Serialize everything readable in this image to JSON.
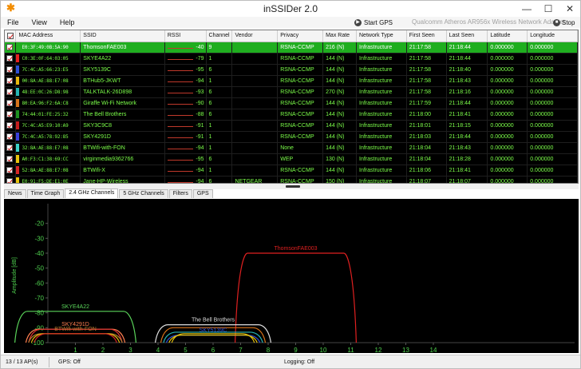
{
  "window": {
    "title": "inSSIDer 2.0",
    "minimize": "—",
    "maximize": "☐",
    "close": "✕"
  },
  "menu": [
    {
      "label": "File"
    },
    {
      "label": "View"
    },
    {
      "label": "Help"
    }
  ],
  "toolbar": {
    "start_gps": "Start GPS",
    "adapter": "Qualcomm Atheros AR956x Wireless Network Adapter",
    "stop": "Stop"
  },
  "table": {
    "columns": [
      "",
      "MAC Address",
      "SSID",
      "RSSI",
      "Channel",
      "Vendor",
      "Privacy",
      "Max Rate",
      "Network Type",
      "First Seen",
      "Last Seen",
      "Latitude",
      "Longitude"
    ],
    "rows": [
      {
        "color": "#1fae1f",
        "mac": "E0:3F:49:0B:5A:90",
        "ssid": "ThomsonFAE003",
        "rssi": "-40",
        "ch": "9",
        "vendor": "",
        "privacy": "RSNA-CCMP",
        "rate": "216 (N)",
        "type": "Infrastructure",
        "first": "21:17:58",
        "last": "21:18:44",
        "lat": "0.000000",
        "lon": "0.000000"
      },
      {
        "color": "#e81f1f",
        "mac": "C0:3E:0F:64:03:05",
        "ssid": "SKYE4A22",
        "rssi": "-79",
        "ch": "1",
        "vendor": "",
        "privacy": "RSNA-CCMP",
        "rate": "144 (N)",
        "type": "Infrastructure",
        "first": "21:17:58",
        "last": "21:18:44",
        "lat": "0.000000",
        "lon": "0.000000"
      },
      {
        "color": "#2e4fd6",
        "mac": "7C:4C:A5:66:23:E5",
        "ssid": "SKY5139C",
        "rssi": "-95",
        "ch": "6",
        "vendor": "",
        "privacy": "RSNA-CCMP",
        "rate": "144 (N)",
        "type": "Infrastructure",
        "first": "21:17:58",
        "last": "21:18:40",
        "lat": "0.000000",
        "lon": "0.000000"
      },
      {
        "color": "#e8b80c",
        "mac": "00:8A:AE:88:E7:08",
        "ssid": "BTHub5-JKWT",
        "rssi": "-94",
        "ch": "1",
        "vendor": "",
        "privacy": "RSNA-CCMP",
        "rate": "144 (N)",
        "type": "Infrastructure",
        "first": "21:17:58",
        "last": "21:18:43",
        "lat": "0.000000",
        "lon": "0.000000"
      },
      {
        "color": "#26b5b5",
        "mac": "48:EE:0C:26:D8:98",
        "ssid": "TALKTALK-26D898",
        "rssi": "-93",
        "ch": "6",
        "vendor": "",
        "privacy": "RSNA-CCMP",
        "rate": "270 (N)",
        "type": "Infrastructure",
        "first": "21:17:58",
        "last": "21:18:16",
        "lat": "0.000000",
        "lon": "0.000000"
      },
      {
        "color": "#d9731a",
        "mac": "80:EA:96:F2:6A:C8",
        "ssid": "Giraffe Wi-Fi Network",
        "rssi": "-90",
        "ch": "6",
        "vendor": "",
        "privacy": "RSNA-CCMP",
        "rate": "144 (N)",
        "type": "Infrastructure",
        "first": "21:17:59",
        "last": "21:18:44",
        "lat": "0.000000",
        "lon": "0.000000"
      },
      {
        "color": "#1e8f1e",
        "mac": "74:44:01:FE:25:32",
        "ssid": "The Bell Brothers",
        "rssi": "-88",
        "ch": "6",
        "vendor": "",
        "privacy": "RSNA-CCMP",
        "rate": "144 (N)",
        "type": "Infrastructure",
        "first": "21:18:00",
        "last": "21:18:41",
        "lat": "0.000000",
        "lon": "0.000000"
      },
      {
        "color": "#c41d1d",
        "mac": "7C:4C:A5:E9:10:A9",
        "ssid": "SKY3C9C8",
        "rssi": "-91",
        "ch": "1",
        "vendor": "",
        "privacy": "RSNA-CCMP",
        "rate": "144 (N)",
        "type": "Infrastructure",
        "first": "21:18:01",
        "last": "21:18:15",
        "lat": "0.000000",
        "lon": "0.000000"
      },
      {
        "color": "#3a3fd9",
        "mac": "7C:4C:A5:78:92:85",
        "ssid": "SKY4291D",
        "rssi": "-91",
        "ch": "1",
        "vendor": "",
        "privacy": "RSNA-CCMP",
        "rate": "144 (N)",
        "type": "Infrastructure",
        "first": "21:18:03",
        "last": "21:18:44",
        "lat": "0.000000",
        "lon": "0.000000"
      },
      {
        "color": "#3ad1c8",
        "mac": "32:8A:AE:88:E7:08",
        "ssid": "BTWifi-with-FON",
        "rssi": "-94",
        "ch": "1",
        "vendor": "",
        "privacy": "None",
        "rate": "144 (N)",
        "type": "Infrastructure",
        "first": "21:18:04",
        "last": "21:18:43",
        "lat": "0.000000",
        "lon": "0.000000"
      },
      {
        "color": "#e8c40c",
        "mac": "A0:F3:C1:38:69:CC",
        "ssid": "virginmedia9362766",
        "rssi": "-95",
        "ch": "6",
        "vendor": "",
        "privacy": "WEP",
        "rate": "130 (N)",
        "type": "Infrastructure",
        "first": "21:18:04",
        "last": "21:18:28",
        "lat": "0.000000",
        "lon": "0.000000"
      },
      {
        "color": "#d62424",
        "mac": "52:8A:AE:88:E7:08",
        "ssid": "BTWifi-X",
        "rssi": "-94",
        "ch": "1",
        "vendor": "",
        "privacy": "RSNA-CCMP",
        "rate": "144 (N)",
        "type": "Infrastructure",
        "first": "21:18:06",
        "last": "21:18:41",
        "lat": "0.000000",
        "lon": "0.000000"
      },
      {
        "color": "#e8c40c",
        "mac": "E0:91:F5:DE:E1:0E",
        "ssid": "Jane-HP-Wireless",
        "rssi": "-94",
        "ch": "6",
        "vendor": "NETGEAR",
        "privacy": "RSNA-CCMP",
        "rate": "150 (N)",
        "type": "Infrastructure",
        "first": "21:18:07",
        "last": "21:18:07",
        "lat": "0.000000",
        "lon": "0.000000"
      }
    ]
  },
  "tabs": [
    {
      "label": "News"
    },
    {
      "label": "Time Graph"
    },
    {
      "label": "2.4 GHz Channels",
      "active": true
    },
    {
      "label": "5 GHz Channels"
    },
    {
      "label": "Filters"
    },
    {
      "label": "GPS"
    }
  ],
  "chart_data": {
    "type": "area",
    "ylabel": "Amplitude [dB]",
    "ylim": [
      -100,
      -10
    ],
    "yticks": [
      -20,
      -30,
      -40,
      -50,
      -60,
      -70,
      -80,
      -90,
      -100
    ],
    "xticks": [
      1,
      2,
      3,
      4,
      5,
      6,
      7,
      8,
      9,
      10,
      11,
      12,
      13,
      14
    ],
    "grid": false,
    "series": [
      {
        "name": "ThomsonFAE003",
        "channel": 9,
        "rssi": -40,
        "color": "#e02020",
        "width": 4.4,
        "label": true
      },
      {
        "name": "SKYE4A22",
        "channel": 1,
        "rssi": -79,
        "color": "#5ad45a",
        "width": 4.4,
        "label": true
      },
      {
        "name": "SKY4291D",
        "channel": 1,
        "rssi": -91,
        "color": "#ff7f50",
        "width": 3.6,
        "label": true
      },
      {
        "name": "SKY3C9C8",
        "channel": 1,
        "rssi": -91,
        "color": "#e03030",
        "width": 3.4,
        "label": false
      },
      {
        "name": "BTWifi-with-FON",
        "channel": 1,
        "rssi": -94,
        "color": "#b07a30",
        "width": 3.4,
        "label": true
      },
      {
        "name": "BTHub5-JKWT",
        "channel": 1,
        "rssi": -94,
        "color": "#e8b80c",
        "width": 3.2,
        "label": false
      },
      {
        "name": "BTWifi-X",
        "channel": 1,
        "rssi": -94,
        "color": "#d62424",
        "width": 3.0,
        "label": false
      },
      {
        "name": "The Bell Brothers",
        "channel": 6,
        "rssi": -88,
        "color": "#dddddd",
        "width": 4.2,
        "label": true
      },
      {
        "name": "Giraffe Wi-Fi Network",
        "channel": 6,
        "rssi": -90,
        "color": "#d9731a",
        "width": 3.8,
        "label": false
      },
      {
        "name": "TALKTALK-26D898",
        "channel": 6,
        "rssi": -93,
        "color": "#26b5b5",
        "width": 3.6,
        "label": false
      },
      {
        "name": "SKY5139C",
        "channel": 6,
        "rssi": -95,
        "color": "#2e4fd6",
        "width": 3.4,
        "label": true
      },
      {
        "name": "virginmedia9362766",
        "channel": 6,
        "rssi": -95,
        "color": "#e8c40c",
        "width": 3.2,
        "label": false
      },
      {
        "name": "Jane-HP-Wireless",
        "channel": 6,
        "rssi": -94,
        "color": "#e8c40c",
        "width": 3.0,
        "label": false
      }
    ]
  },
  "status": {
    "aps": "13 / 13 AP(s)",
    "gps": "GPS: Off",
    "logging": "Logging: Off"
  }
}
